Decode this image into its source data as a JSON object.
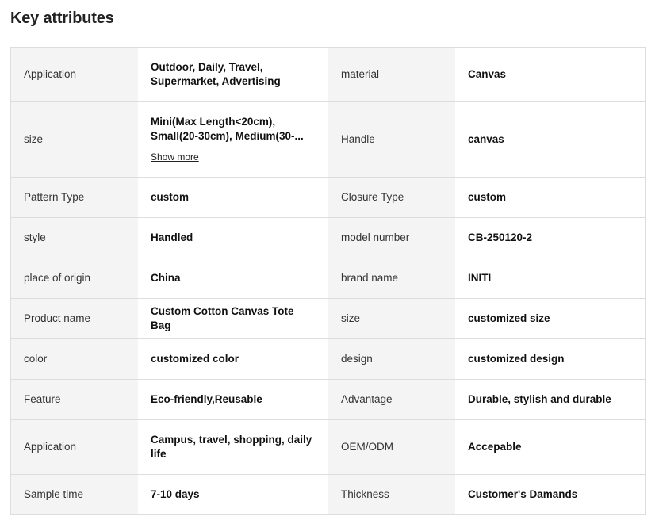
{
  "title": "Key attributes",
  "show_more_label": "Show more",
  "rows": [
    {
      "k1": "Application",
      "v1": "Outdoor, Daily, Travel, Supermarket, Advertising",
      "k2": "material",
      "v2": "Canvas"
    },
    {
      "k1": "size",
      "v1": "Mini(Max Length<20cm), Small(20-30cm), Medium(30-...",
      "k2": "Handle",
      "v2": "canvas"
    },
    {
      "k1": "Pattern Type",
      "v1": "custom",
      "k2": "Closure Type",
      "v2": "custom"
    },
    {
      "k1": "style",
      "v1": "Handled",
      "k2": "model number",
      "v2": "CB-250120-2"
    },
    {
      "k1": "place of origin",
      "v1": "China",
      "k2": "brand name",
      "v2": "INITI"
    },
    {
      "k1": "Product name",
      "v1": "Custom Cotton Canvas Tote Bag",
      "k2": "size",
      "v2": "customized size"
    },
    {
      "k1": "color",
      "v1": "customized color",
      "k2": "design",
      "v2": "customized design"
    },
    {
      "k1": "Feature",
      "v1": "Eco-friendly,Reusable",
      "k2": "Advantage",
      "v2": "Durable, stylish and durable"
    },
    {
      "k1": "Application",
      "v1": "Campus, travel, shopping, daily life",
      "k2": "OEM/ODM",
      "v2": "Accepable"
    },
    {
      "k1": "Sample time",
      "v1": "7-10 days",
      "k2": "Thickness",
      "v2": "Customer's Damands"
    }
  ]
}
